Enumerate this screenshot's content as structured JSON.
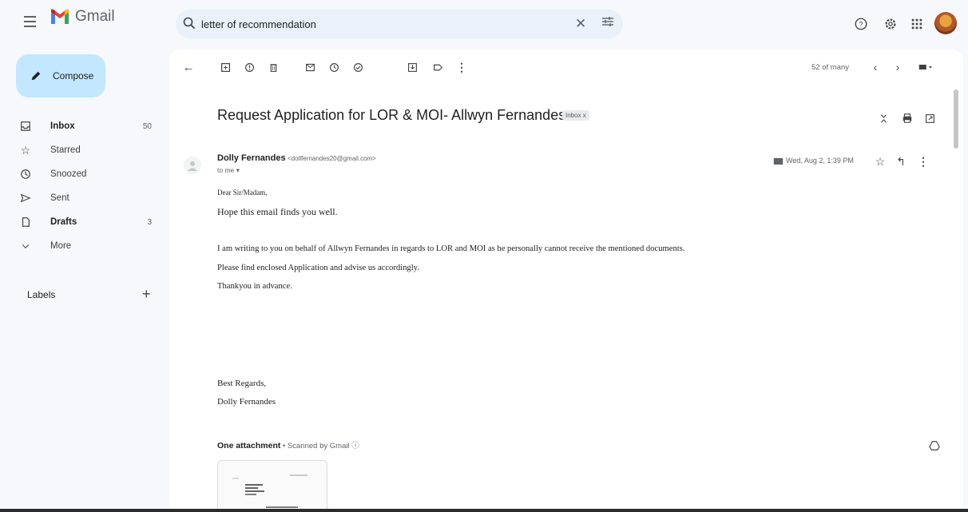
{
  "app": {
    "name": "Gmail"
  },
  "search": {
    "query": "letter of recommendation"
  },
  "sidebar": {
    "compose_label": "Compose",
    "items": [
      {
        "label": "Inbox",
        "count": "50",
        "bold": true
      },
      {
        "label": "Starred",
        "count": ""
      },
      {
        "label": "Snoozed",
        "count": ""
      },
      {
        "label": "Sent",
        "count": ""
      },
      {
        "label": "Drafts",
        "count": "3",
        "bold": true
      },
      {
        "label": "More",
        "count": ""
      }
    ],
    "labels_title": "Labels",
    "labels_add": "+"
  },
  "toolbar": {
    "pager": "52 of many"
  },
  "email": {
    "subject": "Request Application for LOR & MOI- Allwyn Fernandes",
    "badge": "Inbox x",
    "sender_name": "Dolly Fernandes",
    "sender_email": "<dollfernandes20@gmail.com>",
    "to": "to me ▾",
    "date": "Wed, Aug 2, 1:39 PM",
    "body": {
      "greeting": "Dear Sir/Madam,",
      "line1": "Hope this email finds you well.",
      "line2": "I am writing to you on behalf of Allwyn Fernandes in regards to LOR and MOI as he personally cannot receive the mentioned documents.",
      "line3": "Please find enclosed Application and advise us accordingly.",
      "line4": "Thankyou in advance.",
      "closing1": "Best Regards,",
      "closing2": "Dolly Fernandes"
    },
    "attachment_count": "One attachment",
    "attachment_note": " • Scanned by Gmail ⓘ"
  },
  "colors": {
    "compose_bg": "#c2e7ff",
    "search_bg": "#eaf1fb",
    "app_bg": "#f6f8fc"
  }
}
